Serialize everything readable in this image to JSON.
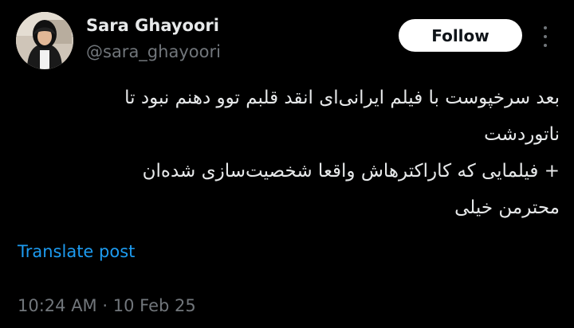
{
  "author": {
    "display_name": "Sara Ghayoori",
    "handle": "@sara_ghayoori"
  },
  "follow_button": {
    "label": "Follow"
  },
  "more_menu": {
    "icon": "more-vertical-icon"
  },
  "tweet": {
    "lines": [
      "بعد سرخپوست با فیلم ایرانی‌ای انقد قلبم توو دهنم نبود تا",
      "ناتوردشت",
      "+ فیلمایی که کاراکترهاش واقعا شخصیت‌سازی شده‌ان",
      "محترمن خیلی"
    ]
  },
  "translate": {
    "label": "Translate post"
  },
  "meta": {
    "time": "10:24 AM",
    "separator": "·",
    "date": "10 Feb 25"
  },
  "colors": {
    "background": "#000000",
    "text": "#e7e9ea",
    "secondary": "#71767b",
    "link": "#1d9bf0",
    "follow_bg": "#ffffff"
  }
}
